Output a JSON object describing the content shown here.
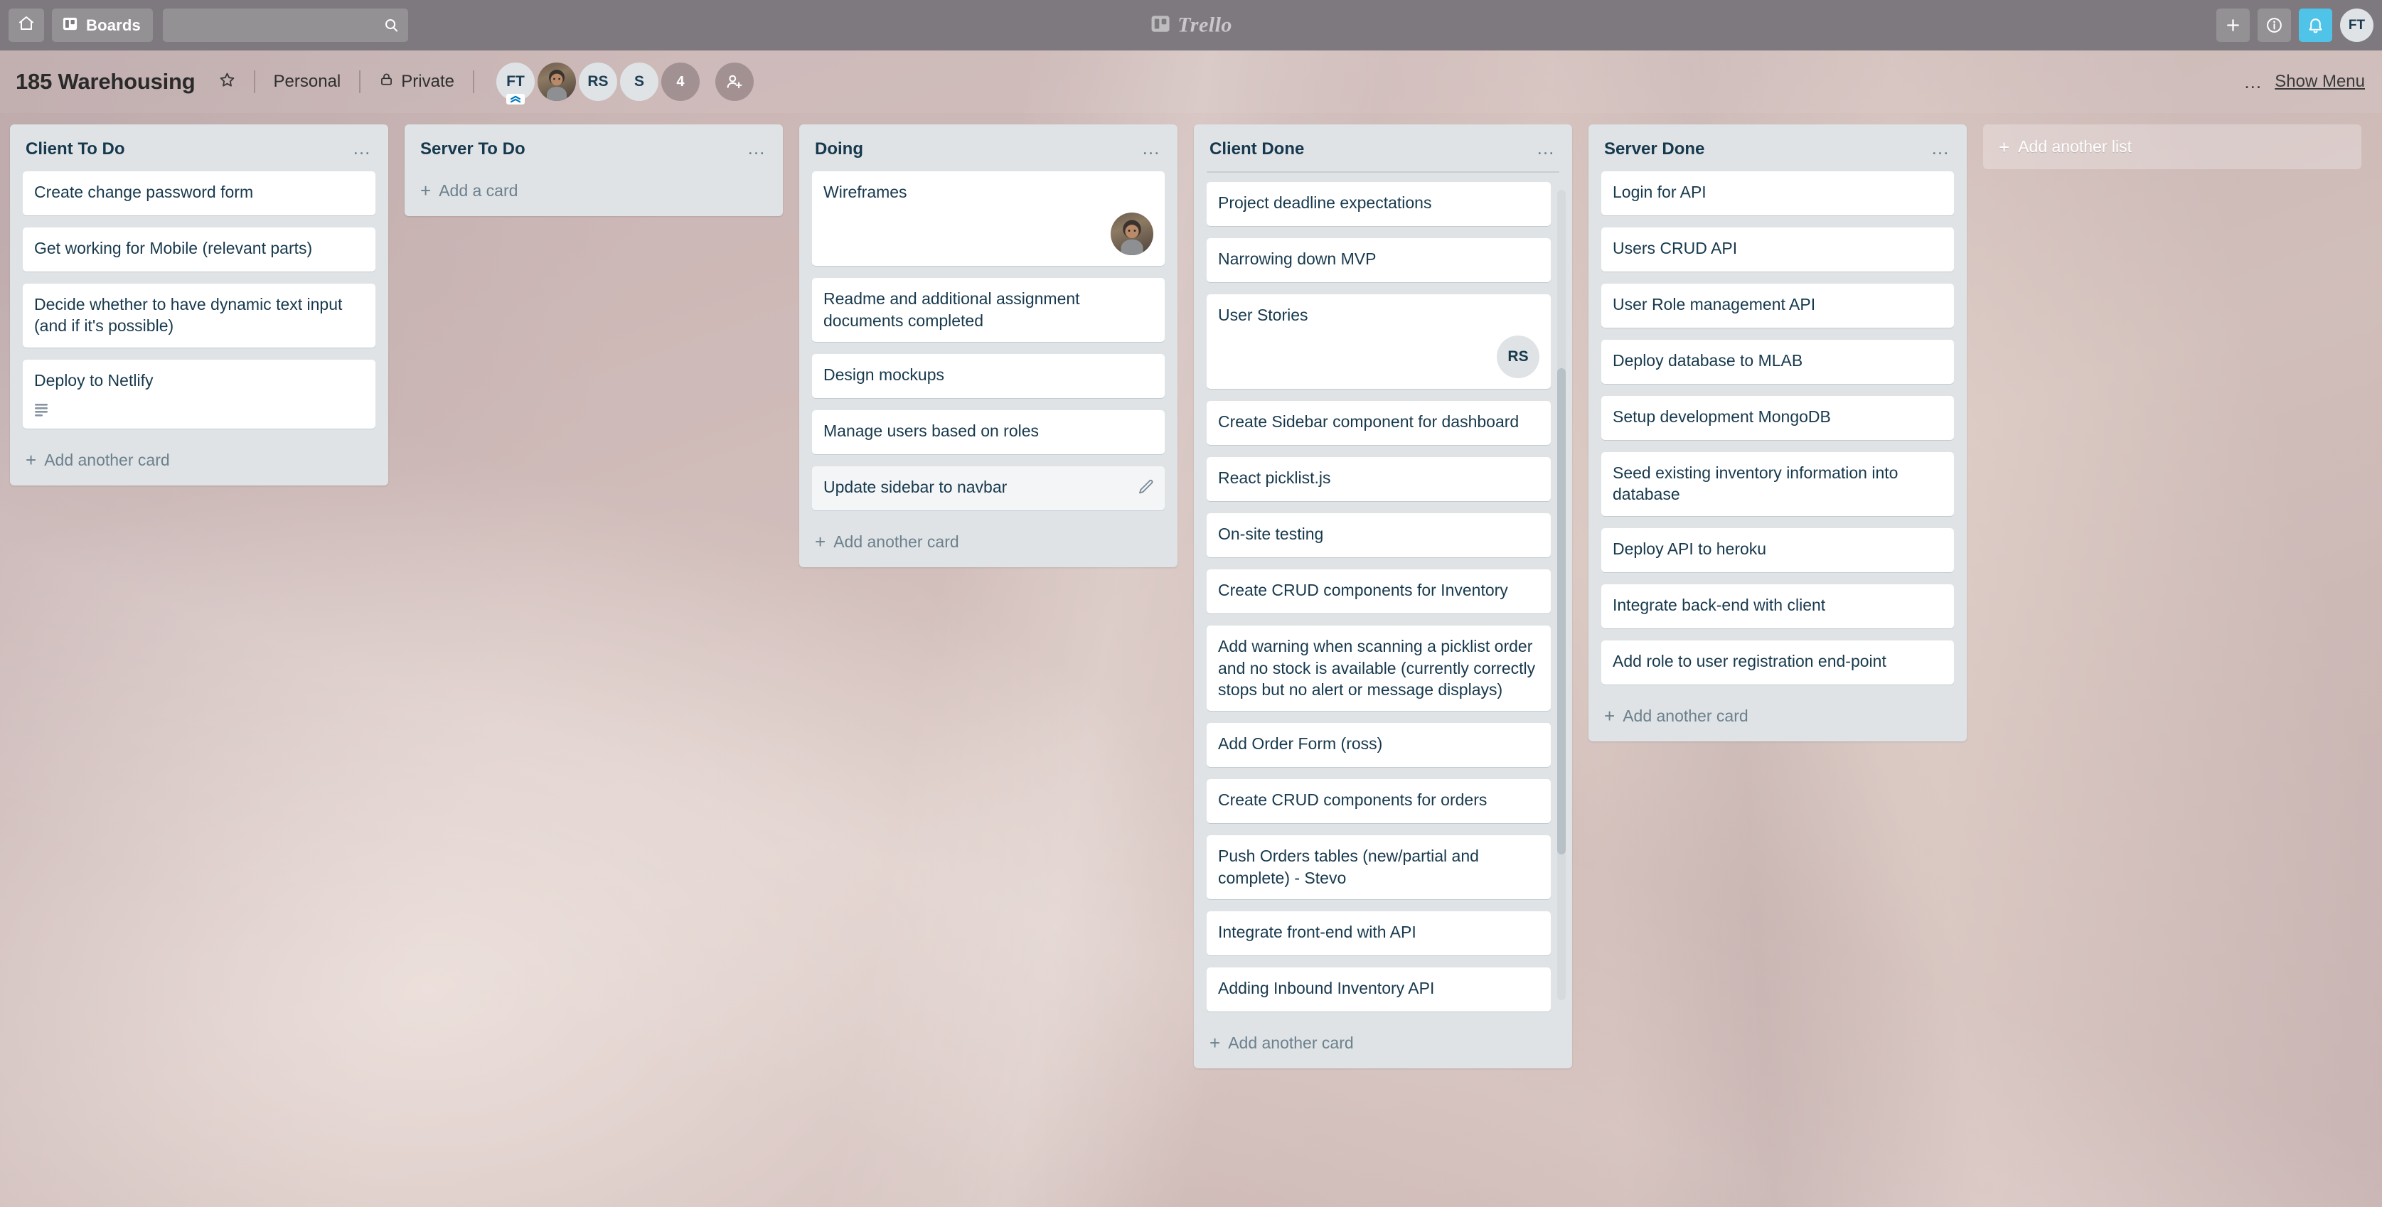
{
  "top_bar": {
    "home_icon": "home-icon",
    "boards_label": "Boards",
    "boards_icon": "board-icon",
    "search": {
      "value": "",
      "placeholder": "",
      "icon": "search-icon"
    },
    "logo": {
      "mark": "trello-logo-icon",
      "wordmark": "Trello"
    },
    "actions": [
      {
        "name": "add",
        "icon": "plus-icon",
        "label": "+"
      },
      {
        "name": "information",
        "icon": "info-icon",
        "label": "i"
      },
      {
        "name": "notifications",
        "icon": "bell-icon",
        "label": "",
        "accent": "#4fc3e8"
      }
    ],
    "user_initials": "FT"
  },
  "board_header": {
    "title": "185 Warehousing",
    "star_icon": "star-icon",
    "workspace": "Personal",
    "visibility": "Private",
    "lock_icon": "lock-icon",
    "members": [
      {
        "initials": "FT",
        "type": "initials",
        "admin_badge": true
      },
      {
        "initials": "",
        "type": "photo",
        "admin_badge": false
      },
      {
        "initials": "RS",
        "type": "initials",
        "admin_badge": false
      },
      {
        "initials": "S",
        "type": "initials",
        "admin_badge": false
      },
      {
        "initials": "4",
        "type": "count",
        "admin_badge": false
      }
    ],
    "add_member_icon": "add-member-icon",
    "menu_dots": "…",
    "show_menu_label": "Show Menu"
  },
  "lists": [
    {
      "title": "Client To Do",
      "dots": "…",
      "add_card_label": "Add another card",
      "scrolled": false,
      "cards": [
        {
          "title": "Create change password form",
          "description_badge": false,
          "member": null,
          "hovered": false
        },
        {
          "title": "Get working for Mobile (relevant parts)",
          "description_badge": false,
          "member": null,
          "hovered": false
        },
        {
          "title": "Decide whether to have dynamic text input (and if it's possible)",
          "description_badge": false,
          "member": null,
          "hovered": false
        },
        {
          "title": "Deploy to Netlify",
          "description_badge": true,
          "member": null,
          "hovered": false
        }
      ]
    },
    {
      "title": "Server To Do",
      "dots": "…",
      "add_card_label": "Add a card",
      "scrolled": false,
      "cards": []
    },
    {
      "title": "Doing",
      "dots": "…",
      "add_card_label": "Add another card",
      "scrolled": false,
      "cards": [
        {
          "title": "Wireframes",
          "description_badge": false,
          "member": {
            "initials": "",
            "type": "photo"
          },
          "hovered": false
        },
        {
          "title": "Readme and additional assignment documents completed",
          "description_badge": false,
          "member": null,
          "hovered": false
        },
        {
          "title": "Design mockups",
          "description_badge": false,
          "member": null,
          "hovered": false
        },
        {
          "title": "Manage users based on roles",
          "description_badge": false,
          "member": null,
          "hovered": false
        },
        {
          "title": "Update sidebar to navbar",
          "description_badge": false,
          "member": null,
          "hovered": true
        }
      ]
    },
    {
      "title": "Client Done",
      "dots": "…",
      "add_card_label": "Add another card",
      "scrolled": true,
      "cards": [
        {
          "title": "Project deadline expectations",
          "description_badge": false,
          "member": null,
          "hovered": false
        },
        {
          "title": "Narrowing down MVP",
          "description_badge": false,
          "member": null,
          "hovered": false
        },
        {
          "title": "User Stories",
          "description_badge": false,
          "member": {
            "initials": "RS",
            "type": "initials"
          },
          "hovered": false
        },
        {
          "title": "Create Sidebar component for dashboard",
          "description_badge": false,
          "member": null,
          "hovered": false
        },
        {
          "title": "React picklist.js",
          "description_badge": false,
          "member": null,
          "hovered": false
        },
        {
          "title": "On-site testing",
          "description_badge": false,
          "member": null,
          "hovered": false
        },
        {
          "title": "Create CRUD components for Inventory",
          "description_badge": false,
          "member": null,
          "hovered": false
        },
        {
          "title": "Add warning when scanning a picklist order and no stock is available (currently correctly stops but no alert or message displays)",
          "description_badge": false,
          "member": null,
          "hovered": false
        },
        {
          "title": "Add Order Form (ross)",
          "description_badge": false,
          "member": null,
          "hovered": false
        },
        {
          "title": "Create CRUD components for orders",
          "description_badge": false,
          "member": null,
          "hovered": false
        },
        {
          "title": "Push Orders tables (new/partial and complete) - Stevo",
          "description_badge": false,
          "member": null,
          "hovered": false
        },
        {
          "title": "Integrate front-end with API",
          "description_badge": false,
          "member": null,
          "hovered": false
        },
        {
          "title": "Adding Inbound Inventory API",
          "description_badge": false,
          "member": null,
          "hovered": false
        }
      ]
    },
    {
      "title": "Server Done",
      "dots": "…",
      "add_card_label": "Add another card",
      "scrolled": false,
      "cards": [
        {
          "title": "Login for API",
          "description_badge": false,
          "member": null,
          "hovered": false
        },
        {
          "title": "Users CRUD API",
          "description_badge": false,
          "member": null,
          "hovered": false
        },
        {
          "title": "User Role management API",
          "description_badge": false,
          "member": null,
          "hovered": false
        },
        {
          "title": "Deploy database to MLAB",
          "description_badge": false,
          "member": null,
          "hovered": false
        },
        {
          "title": "Setup development MongoDB",
          "description_badge": false,
          "member": null,
          "hovered": false
        },
        {
          "title": "Seed existing inventory information into database",
          "description_badge": false,
          "member": null,
          "hovered": false
        },
        {
          "title": "Deploy API to heroku",
          "description_badge": false,
          "member": null,
          "hovered": false
        },
        {
          "title": "Integrate back-end with client",
          "description_badge": false,
          "member": null,
          "hovered": false
        },
        {
          "title": "Add role to user registration end-point",
          "description_badge": false,
          "member": null,
          "hovered": false
        }
      ]
    }
  ],
  "add_list_label": "Add another list",
  "colors": {
    "top_bar": "#7d797e",
    "list_bg": "#dfe3e6",
    "card_bg": "#ffffff",
    "card_text": "#17394d",
    "muted_text": "#6b808c",
    "notification_accent": "#4fc3e8",
    "board_bg": "#d3c0be"
  }
}
